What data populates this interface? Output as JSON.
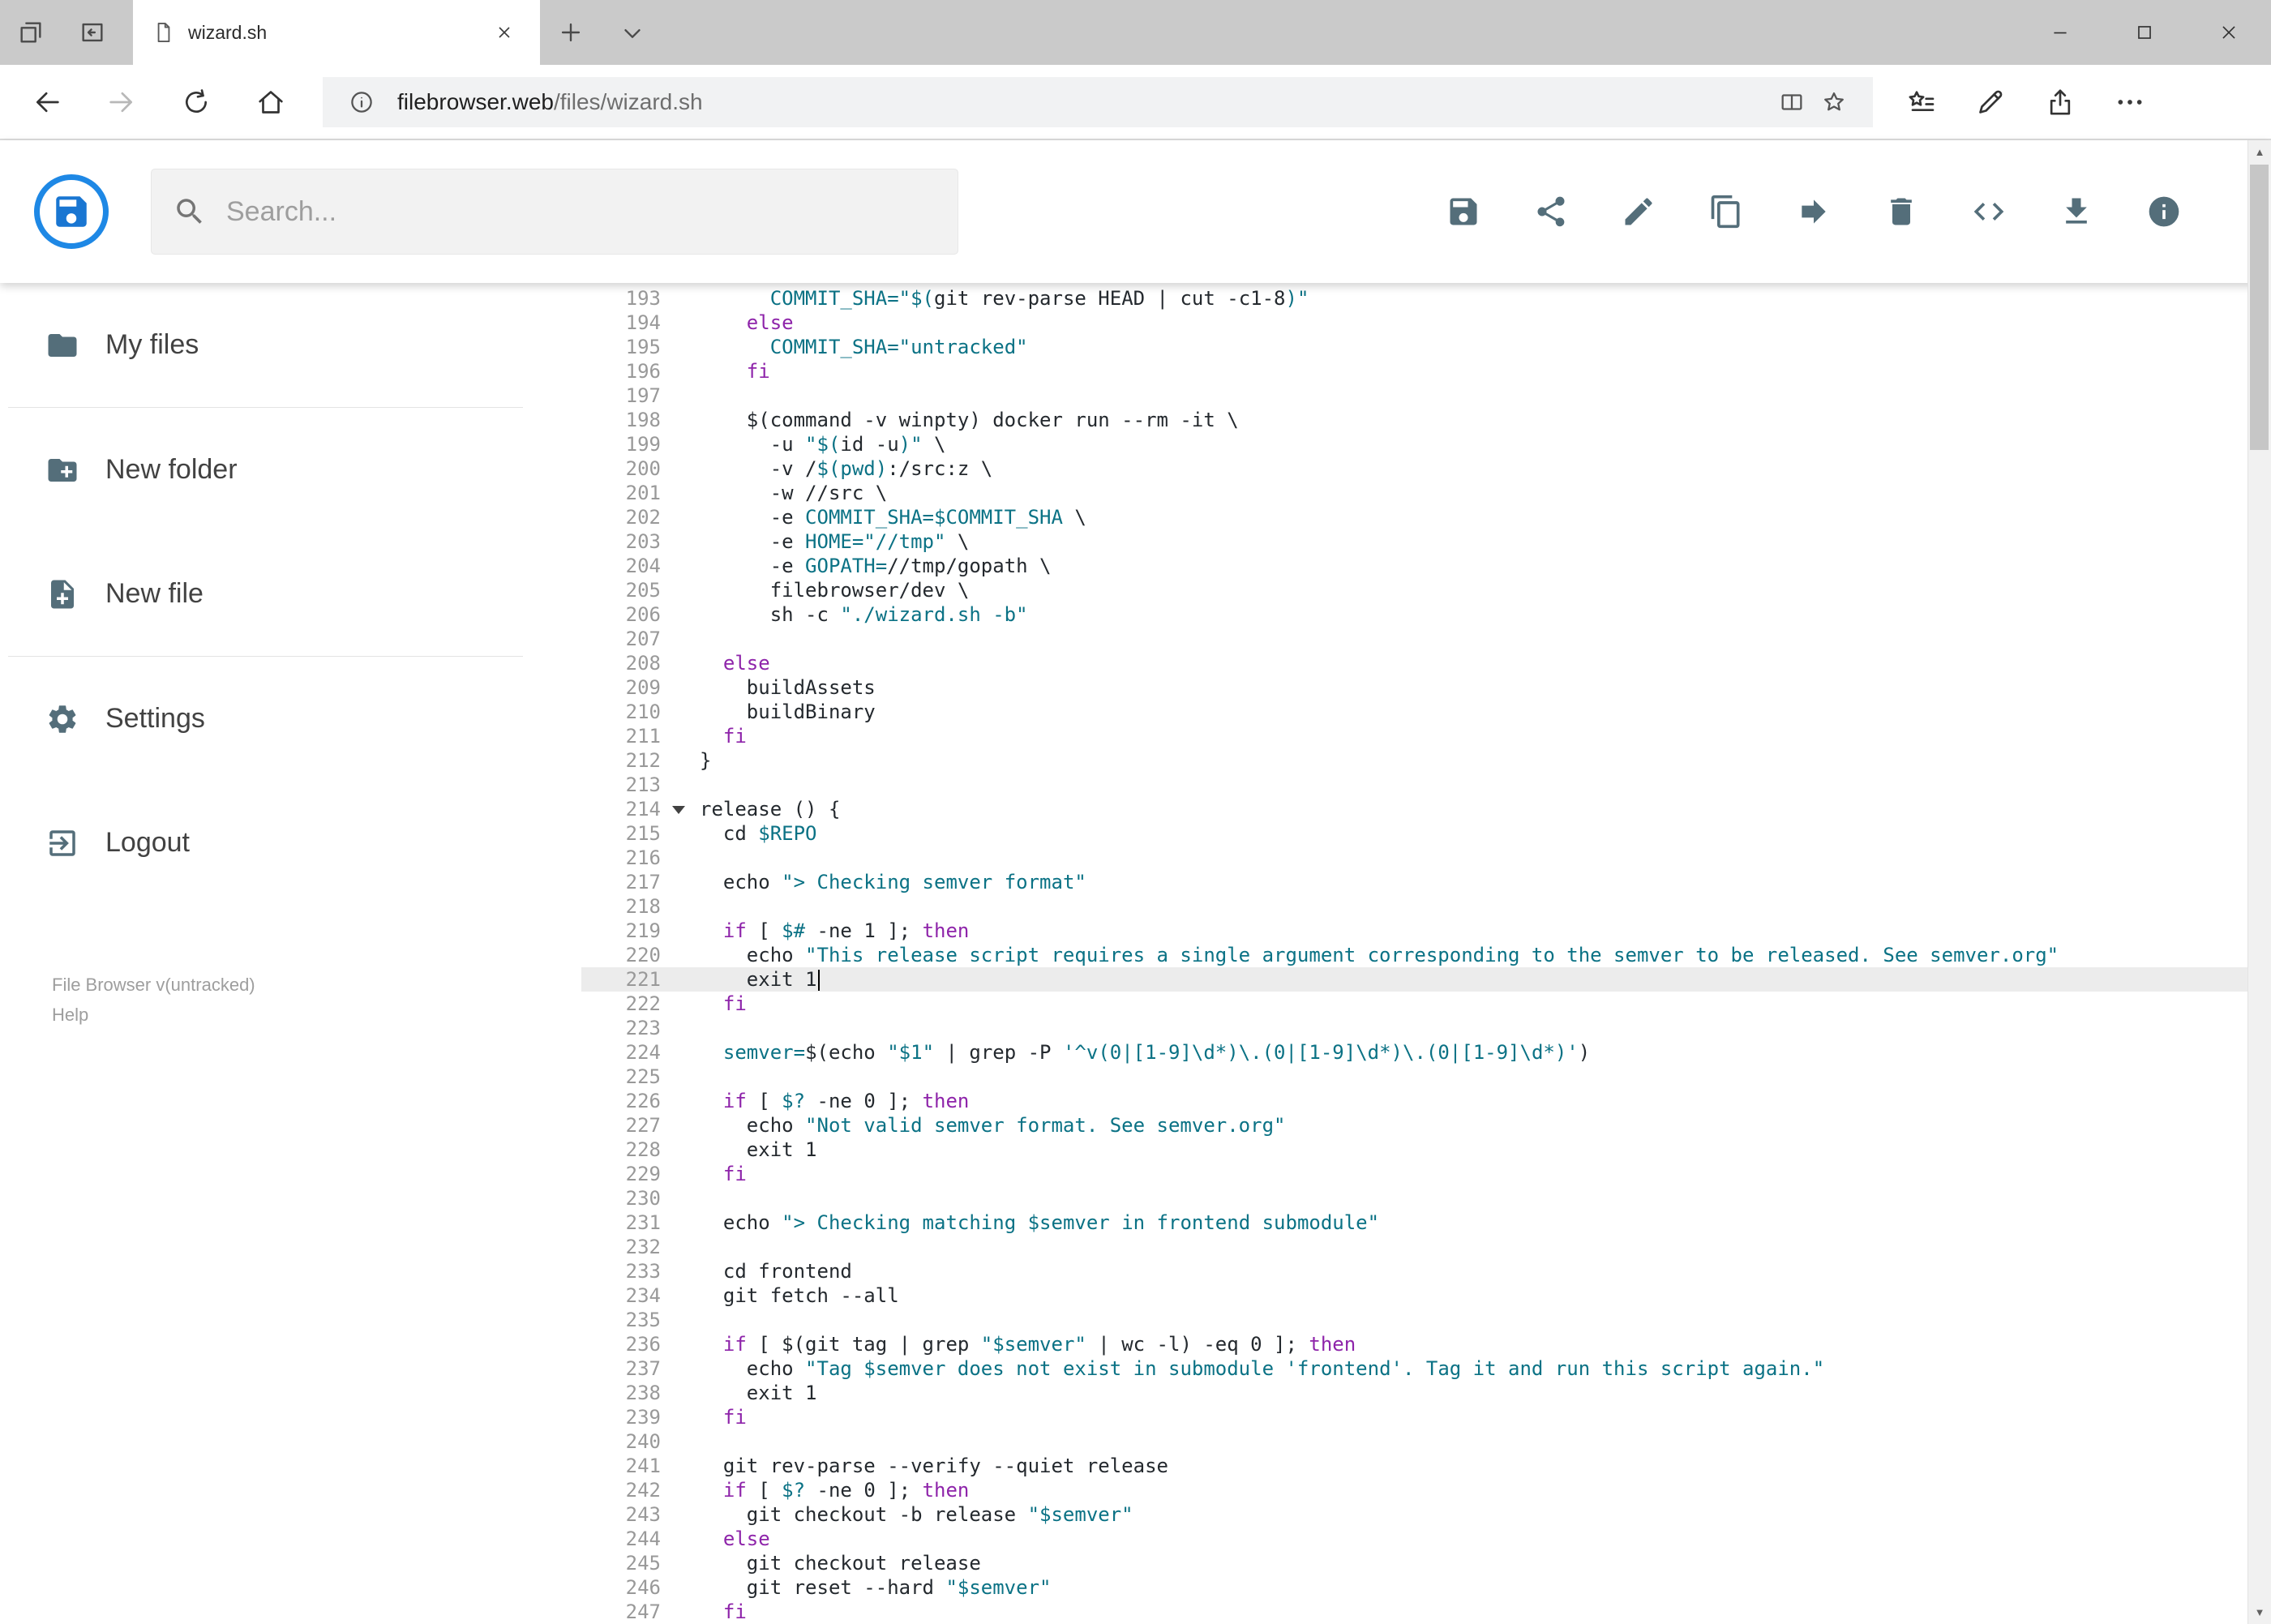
{
  "colors": {
    "accent": "#1e88e5",
    "icon": "#546e7a",
    "keyword": "#8e24aa",
    "string": "#0b7285",
    "variable": "#0b7285",
    "text": "#24292e",
    "line_number": "#999999",
    "active_line_bg": "#ececec"
  },
  "browser": {
    "tab_title": "wizard.sh",
    "url_host": "filebrowser.web",
    "url_path": "/files/wizard.sh"
  },
  "header": {
    "search_placeholder": "Search...",
    "toolbar": [
      {
        "name": "save",
        "icon": "save"
      },
      {
        "name": "share",
        "icon": "share"
      },
      {
        "name": "edit",
        "icon": "edit"
      },
      {
        "name": "copy",
        "icon": "copy"
      },
      {
        "name": "move",
        "icon": "move"
      },
      {
        "name": "delete",
        "icon": "delete"
      },
      {
        "name": "code",
        "icon": "code"
      },
      {
        "name": "download",
        "icon": "download"
      },
      {
        "name": "info",
        "icon": "info"
      }
    ]
  },
  "sidebar": {
    "items": [
      {
        "label": "My files",
        "icon": "folder"
      },
      {
        "label": "New folder",
        "icon": "folder-new"
      },
      {
        "label": "New file",
        "icon": "file-new"
      },
      {
        "label": "Settings",
        "icon": "settings"
      },
      {
        "label": "Logout",
        "icon": "logout"
      }
    ],
    "divider_after": [
      0,
      2
    ],
    "footer": {
      "version": "File Browser v(untracked)",
      "help": "Help"
    }
  },
  "editor": {
    "active_line": 221,
    "cursor_line": 221,
    "fold_line": 214,
    "lines": [
      {
        "n": 193,
        "t": [
          [
            "p",
            "      "
          ],
          [
            "v",
            "COMMIT_SHA="
          ],
          [
            "s",
            "\"$("
          ],
          [
            "p",
            "git rev-parse HEAD | cut -c1-8"
          ],
          [
            "s",
            ")\""
          ]
        ]
      },
      {
        "n": 194,
        "t": [
          [
            "p",
            "    "
          ],
          [
            "k",
            "else"
          ]
        ]
      },
      {
        "n": 195,
        "t": [
          [
            "p",
            "      "
          ],
          [
            "v",
            "COMMIT_SHA="
          ],
          [
            "s",
            "\"untracked\""
          ]
        ]
      },
      {
        "n": 196,
        "t": [
          [
            "p",
            "    "
          ],
          [
            "k",
            "fi"
          ]
        ]
      },
      {
        "n": 197,
        "t": []
      },
      {
        "n": 198,
        "t": [
          [
            "p",
            "    $(command -v winpty) docker run --rm -it \\"
          ]
        ]
      },
      {
        "n": 199,
        "t": [
          [
            "p",
            "      -u "
          ],
          [
            "s",
            "\"$("
          ],
          [
            "p",
            "id -u"
          ],
          [
            "s",
            ")\""
          ],
          [
            "p",
            " \\"
          ]
        ]
      },
      {
        "n": 200,
        "t": [
          [
            "p",
            "      -v /"
          ],
          [
            "v",
            "$(pwd)"
          ],
          [
            "p",
            ":/src:z \\"
          ]
        ]
      },
      {
        "n": 201,
        "t": [
          [
            "p",
            "      -w //src \\"
          ]
        ]
      },
      {
        "n": 202,
        "t": [
          [
            "p",
            "      -e "
          ],
          [
            "v",
            "COMMIT_SHA=$COMMIT_SHA"
          ],
          [
            "p",
            " \\"
          ]
        ]
      },
      {
        "n": 203,
        "t": [
          [
            "p",
            "      -e "
          ],
          [
            "v",
            "HOME="
          ],
          [
            "s",
            "\"//tmp\""
          ],
          [
            "p",
            " \\"
          ]
        ]
      },
      {
        "n": 204,
        "t": [
          [
            "p",
            "      -e "
          ],
          [
            "v",
            "GOPATH="
          ],
          [
            "p",
            "//tmp/gopath \\"
          ]
        ]
      },
      {
        "n": 205,
        "t": [
          [
            "p",
            "      filebrowser/dev \\"
          ]
        ]
      },
      {
        "n": 206,
        "t": [
          [
            "p",
            "      sh -c "
          ],
          [
            "s",
            "\"./wizard.sh -b\""
          ]
        ]
      },
      {
        "n": 207,
        "t": []
      },
      {
        "n": 208,
        "t": [
          [
            "p",
            "  "
          ],
          [
            "k",
            "else"
          ]
        ]
      },
      {
        "n": 209,
        "t": [
          [
            "p",
            "    buildAssets"
          ]
        ]
      },
      {
        "n": 210,
        "t": [
          [
            "p",
            "    buildBinary"
          ]
        ]
      },
      {
        "n": 211,
        "t": [
          [
            "p",
            "  "
          ],
          [
            "k",
            "fi"
          ]
        ]
      },
      {
        "n": 212,
        "t": [
          [
            "p",
            "}"
          ]
        ]
      },
      {
        "n": 213,
        "t": []
      },
      {
        "n": 214,
        "t": [
          [
            "p",
            "release () {"
          ]
        ]
      },
      {
        "n": 215,
        "t": [
          [
            "p",
            "  cd "
          ],
          [
            "v",
            "$REPO"
          ]
        ]
      },
      {
        "n": 216,
        "t": []
      },
      {
        "n": 217,
        "t": [
          [
            "p",
            "  echo "
          ],
          [
            "s",
            "\"> Checking semver format\""
          ]
        ]
      },
      {
        "n": 218,
        "t": []
      },
      {
        "n": 219,
        "t": [
          [
            "p",
            "  "
          ],
          [
            "k",
            "if"
          ],
          [
            "p",
            " [ "
          ],
          [
            "v",
            "$#"
          ],
          [
            "p",
            " -ne 1 ]; "
          ],
          [
            "k",
            "then"
          ]
        ]
      },
      {
        "n": 220,
        "t": [
          [
            "p",
            "    echo "
          ],
          [
            "s",
            "\"This release script requires a single argument corresponding to the semver to be released. See semver.org\""
          ]
        ]
      },
      {
        "n": 221,
        "t": [
          [
            "p",
            "    exit 1"
          ]
        ]
      },
      {
        "n": 222,
        "t": [
          [
            "p",
            "  "
          ],
          [
            "k",
            "fi"
          ]
        ]
      },
      {
        "n": 223,
        "t": []
      },
      {
        "n": 224,
        "t": [
          [
            "p",
            "  "
          ],
          [
            "v",
            "semver="
          ],
          [
            "p",
            "$(echo "
          ],
          [
            "s",
            "\"$1\""
          ],
          [
            "p",
            " | grep -P "
          ],
          [
            "s",
            "'^v(0|[1-9]\\d*)\\.(0|[1-9]\\d*)\\.(0|[1-9]\\d*)'"
          ],
          [
            "p",
            ")"
          ]
        ]
      },
      {
        "n": 225,
        "t": []
      },
      {
        "n": 226,
        "t": [
          [
            "p",
            "  "
          ],
          [
            "k",
            "if"
          ],
          [
            "p",
            " [ "
          ],
          [
            "v",
            "$?"
          ],
          [
            "p",
            " -ne 0 ]; "
          ],
          [
            "k",
            "then"
          ]
        ]
      },
      {
        "n": 227,
        "t": [
          [
            "p",
            "    echo "
          ],
          [
            "s",
            "\"Not valid semver format. See semver.org\""
          ]
        ]
      },
      {
        "n": 228,
        "t": [
          [
            "p",
            "    exit 1"
          ]
        ]
      },
      {
        "n": 229,
        "t": [
          [
            "p",
            "  "
          ],
          [
            "k",
            "fi"
          ]
        ]
      },
      {
        "n": 230,
        "t": []
      },
      {
        "n": 231,
        "t": [
          [
            "p",
            "  echo "
          ],
          [
            "s",
            "\"> Checking matching "
          ],
          [
            "v",
            "$semver"
          ],
          [
            "s",
            " in frontend submodule\""
          ]
        ]
      },
      {
        "n": 232,
        "t": []
      },
      {
        "n": 233,
        "t": [
          [
            "p",
            "  cd frontend"
          ]
        ]
      },
      {
        "n": 234,
        "t": [
          [
            "p",
            "  git fetch --all"
          ]
        ]
      },
      {
        "n": 235,
        "t": []
      },
      {
        "n": 236,
        "t": [
          [
            "p",
            "  "
          ],
          [
            "k",
            "if"
          ],
          [
            "p",
            " [ $(git tag | grep "
          ],
          [
            "s",
            "\"$semver\""
          ],
          [
            "p",
            " | wc -l) -eq 0 ]; "
          ],
          [
            "k",
            "then"
          ]
        ]
      },
      {
        "n": 237,
        "t": [
          [
            "p",
            "    echo "
          ],
          [
            "s",
            "\"Tag "
          ],
          [
            "v",
            "$semver"
          ],
          [
            "s",
            " does not exist in submodule 'frontend'. Tag it and run this script again.\""
          ]
        ]
      },
      {
        "n": 238,
        "t": [
          [
            "p",
            "    exit 1"
          ]
        ]
      },
      {
        "n": 239,
        "t": [
          [
            "p",
            "  "
          ],
          [
            "k",
            "fi"
          ]
        ]
      },
      {
        "n": 240,
        "t": []
      },
      {
        "n": 241,
        "t": [
          [
            "p",
            "  git rev-parse --verify --quiet release"
          ]
        ]
      },
      {
        "n": 242,
        "t": [
          [
            "p",
            "  "
          ],
          [
            "k",
            "if"
          ],
          [
            "p",
            " [ "
          ],
          [
            "v",
            "$?"
          ],
          [
            "p",
            " -ne 0 ]; "
          ],
          [
            "k",
            "then"
          ]
        ]
      },
      {
        "n": 243,
        "t": [
          [
            "p",
            "    git checkout -b release "
          ],
          [
            "s",
            "\"$semver\""
          ]
        ]
      },
      {
        "n": 244,
        "t": [
          [
            "p",
            "  "
          ],
          [
            "k",
            "else"
          ]
        ]
      },
      {
        "n": 245,
        "t": [
          [
            "p",
            "    git checkout release"
          ]
        ]
      },
      {
        "n": 246,
        "t": [
          [
            "p",
            "    git reset --hard "
          ],
          [
            "s",
            "\"$semver\""
          ]
        ]
      },
      {
        "n": 247,
        "t": [
          [
            "p",
            "  "
          ],
          [
            "k",
            "fi"
          ]
        ]
      }
    ]
  }
}
